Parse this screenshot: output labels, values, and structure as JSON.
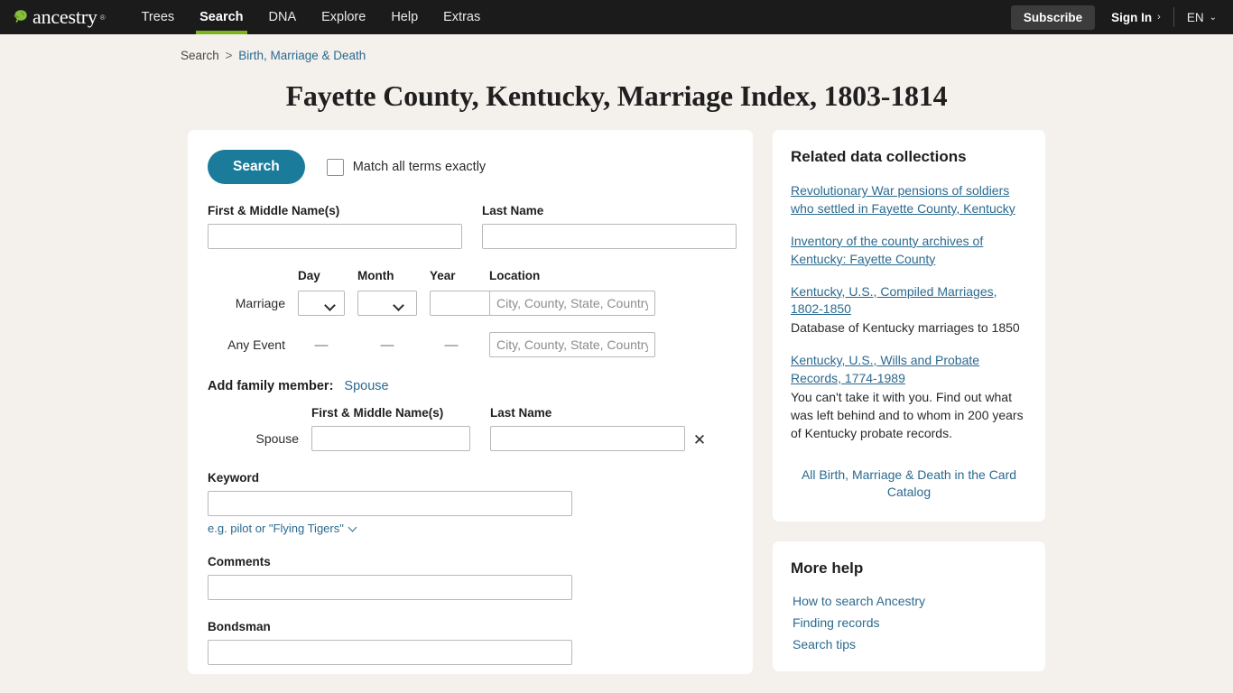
{
  "nav": {
    "brand": "ancestry",
    "brand_tm": "®",
    "items": [
      {
        "label": "Trees",
        "active": false
      },
      {
        "label": "Search",
        "active": true
      },
      {
        "label": "DNA",
        "active": false
      },
      {
        "label": "Explore",
        "active": false
      },
      {
        "label": "Help",
        "active": false
      },
      {
        "label": "Extras",
        "active": false
      }
    ],
    "subscribe_label": "Subscribe",
    "signin_label": "Sign In",
    "signin_chevron": "›",
    "language_label": "EN",
    "language_caret": "⌄"
  },
  "breadcrumb": {
    "root": "Search",
    "separator": ">",
    "current": "Birth, Marriage & Death"
  },
  "page_title": "Fayette County, Kentucky, Marriage Index, 1803-1814",
  "form": {
    "search_button": "Search",
    "match_exactly_label": "Match all terms exactly",
    "first_name_label": "First & Middle Name(s)",
    "last_name_label": "Last Name",
    "first_name_value": "",
    "last_name_value": "",
    "event_headers": {
      "day": "Day",
      "month": "Month",
      "year": "Year",
      "location": "Location"
    },
    "event_rows": [
      {
        "label": "Marriage",
        "day_value": "",
        "month_value": "",
        "year_value": "",
        "location_placeholder": "City, County, State, Country",
        "location_value": "",
        "has_selects": true
      },
      {
        "label": "Any Event",
        "day_value": "—",
        "month_value": "—",
        "year_value": "—",
        "location_placeholder": "City, County, State, Country",
        "location_value": "",
        "has_selects": false
      }
    ],
    "add_family_label": "Add family member:",
    "add_family_link": "Spouse",
    "spouse_headers": {
      "first": "First & Middle Name(s)",
      "last": "Last Name"
    },
    "spouse_row_label": "Spouse",
    "spouse_first_value": "",
    "spouse_last_value": "",
    "remove_spouse_icon": "✕",
    "keyword_label": "Keyword",
    "keyword_value": "",
    "keyword_hint": "e.g. pilot or \"Flying Tigers\"",
    "comments_label": "Comments",
    "comments_value": "",
    "bondsman_label": "Bondsman",
    "bondsman_value": ""
  },
  "related": {
    "title": "Related data collections",
    "items": [
      {
        "link": "Revolutionary War pensions of soldiers who settled in Fayette County, Kentucky",
        "desc": ""
      },
      {
        "link": "Inventory of the county archives of Kentucky: Fayette County",
        "desc": ""
      },
      {
        "link": "Kentucky, U.S., Compiled Marriages, 1802-1850",
        "desc": "Database of Kentucky marriages to 1850"
      },
      {
        "link": "Kentucky, U.S., Wills and Probate Records, 1774-1989",
        "desc": "You can't take it with you. Find out what was left behind and to whom in 200 years of Kentucky probate records."
      }
    ],
    "catalog_link": "All Birth, Marriage & Death in the Card Catalog"
  },
  "more_help": {
    "title": "More help",
    "links": [
      "How to search Ancestry",
      "Finding records",
      "Search tips"
    ]
  },
  "colors": {
    "nav_bg": "#1b1b1b",
    "accent_green": "#7cb518",
    "search_blue": "#1a7b9b",
    "link_blue": "#2b6a8f",
    "page_bg": "#f4f0ec"
  }
}
